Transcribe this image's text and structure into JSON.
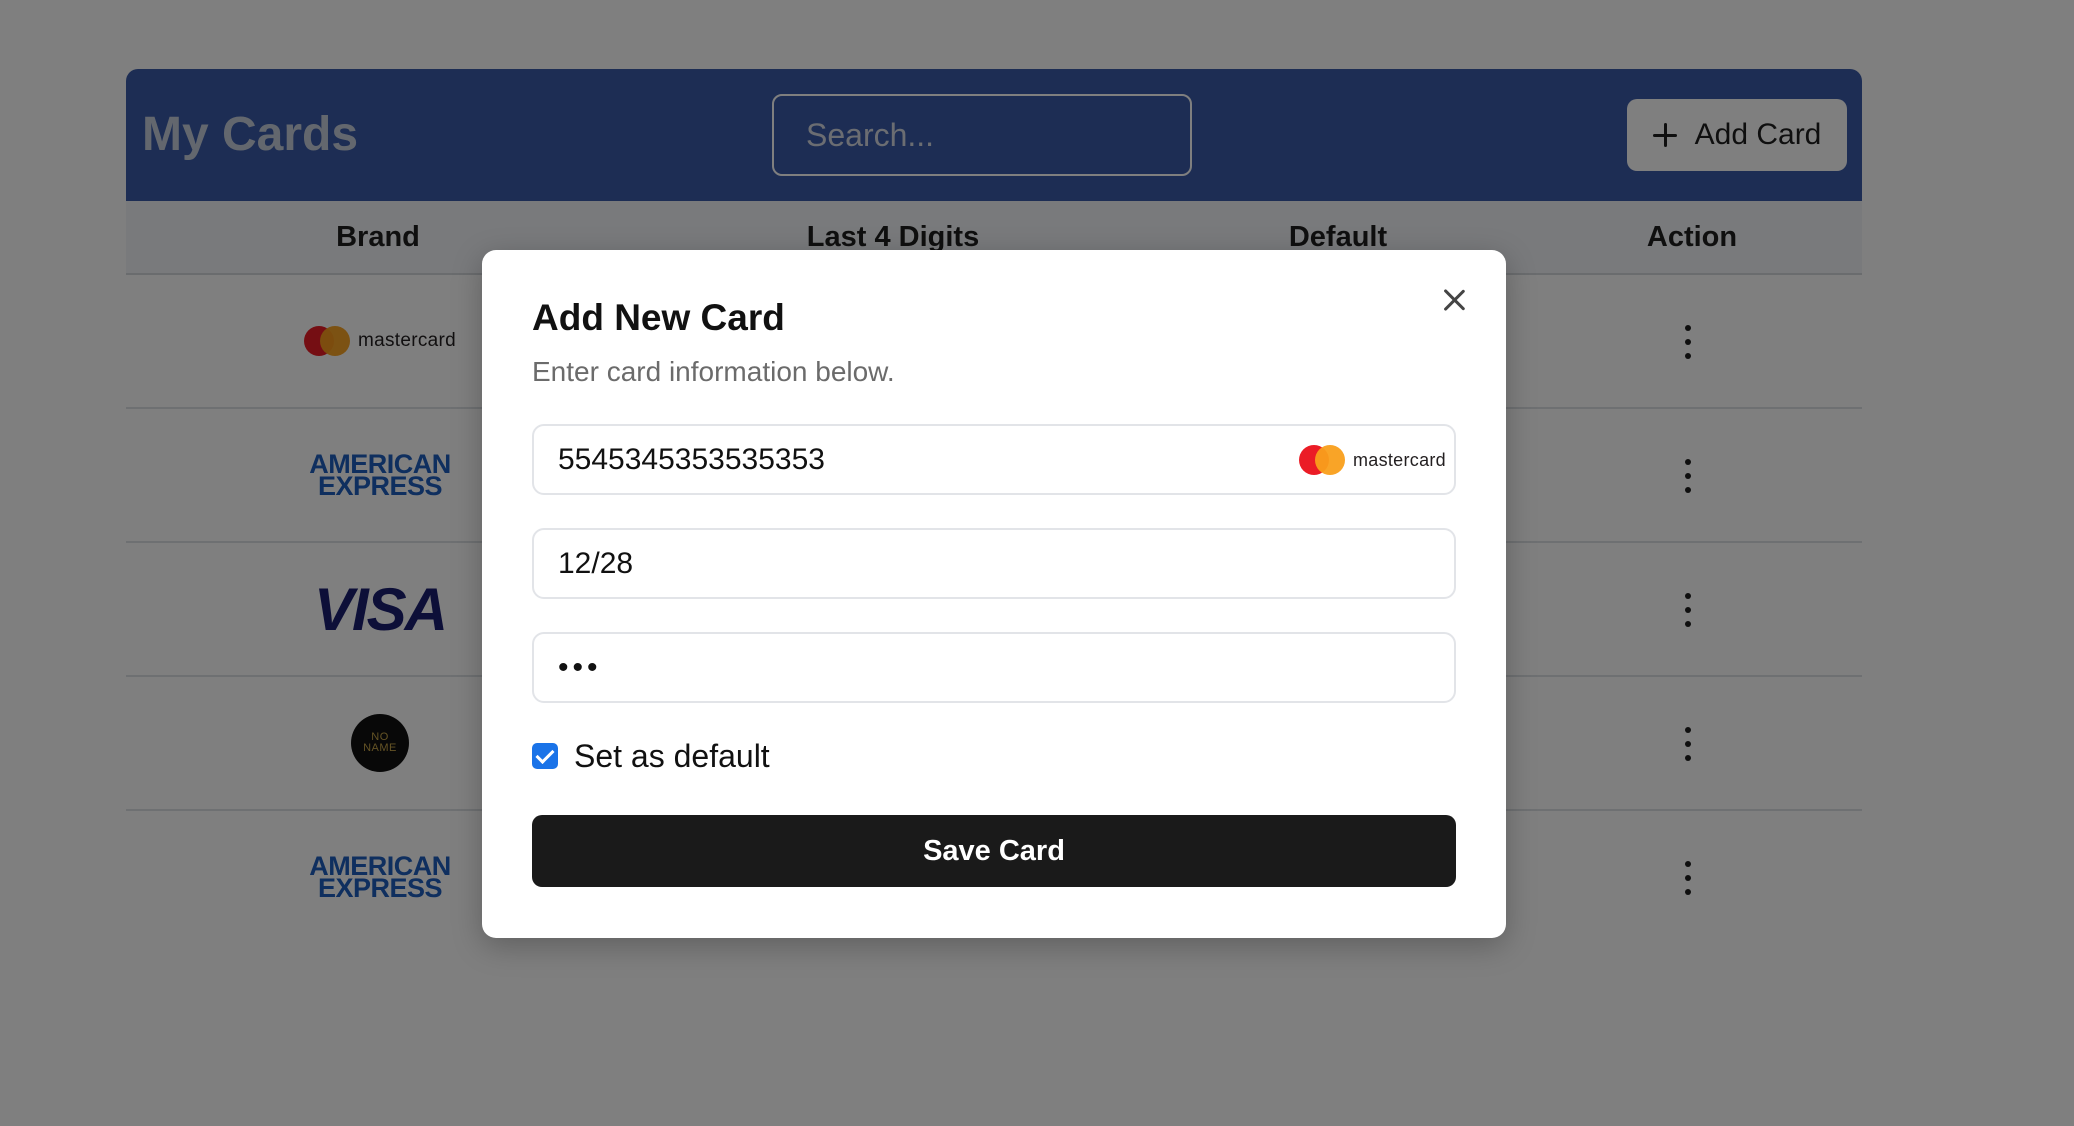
{
  "header": {
    "title": "My Cards",
    "search_placeholder": "Search...",
    "add_card_label": "Add Card"
  },
  "table": {
    "columns": [
      "Brand",
      "Last 4 Digits",
      "Default",
      "Action"
    ],
    "rows": [
      {
        "brand": "mastercard",
        "brand_text": "mastercard"
      },
      {
        "brand": "american-express",
        "brand_text": [
          "AMERICAN",
          "EXPRESS"
        ]
      },
      {
        "brand": "visa",
        "brand_text": "VISA"
      },
      {
        "brand": "noname",
        "brand_text": [
          "NO",
          "NAME"
        ]
      },
      {
        "brand": "american-express",
        "brand_text": [
          "AMERICAN",
          "EXPRESS"
        ]
      }
    ]
  },
  "modal": {
    "title": "Add New Card",
    "subtitle": "Enter card information below.",
    "card_number": "5545345353535353",
    "card_brand": "mastercard",
    "expiry": "12/28",
    "cvv": "•••",
    "set_default_label": "Set as default",
    "set_default_checked": true,
    "save_label": "Save Card"
  },
  "colors": {
    "header_bg": "#3a5aa8",
    "overlay": "rgba(0,0,0,0.5)",
    "checkbox": "#1a73e8",
    "save_button": "#1a1a1a"
  }
}
